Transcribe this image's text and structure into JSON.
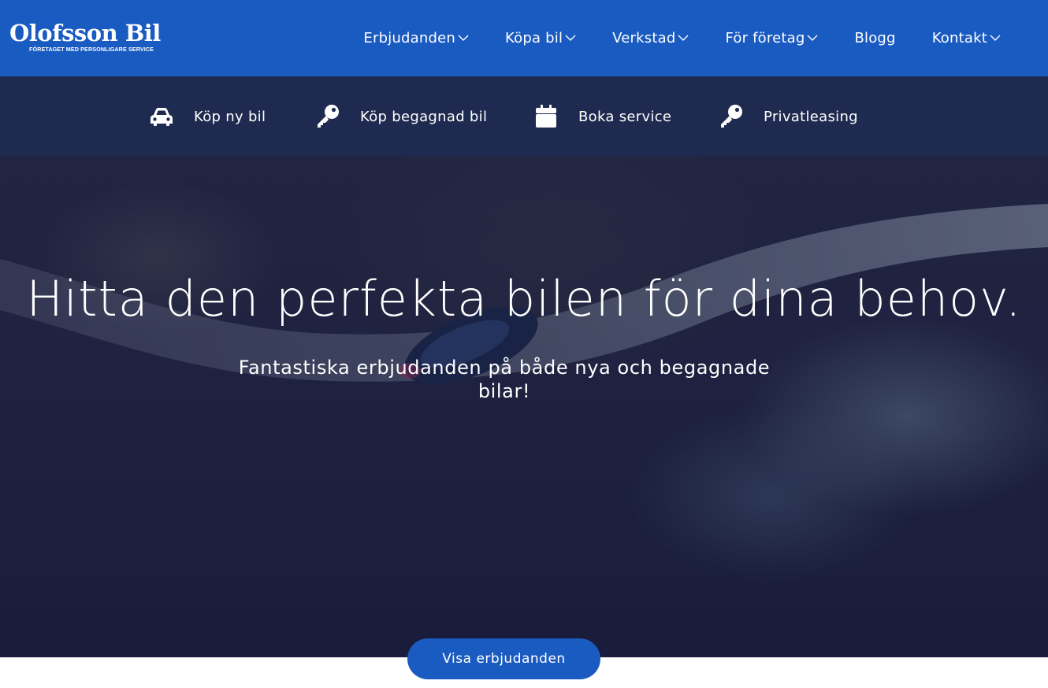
{
  "brand": {
    "name": "Olofsson Bil",
    "tagline": "FÖRETAGET MED PERSONLIGARE SERVICE"
  },
  "nav": {
    "items": [
      {
        "label": "Erbjudanden",
        "has_dropdown": true
      },
      {
        "label": "Köpa bil",
        "has_dropdown": true
      },
      {
        "label": "Verkstad",
        "has_dropdown": true
      },
      {
        "label": "För företag",
        "has_dropdown": true
      },
      {
        "label": "Blogg",
        "has_dropdown": false
      },
      {
        "label": "Kontakt",
        "has_dropdown": true
      }
    ]
  },
  "quicklinks": [
    {
      "label": "Köp ny bil",
      "icon": "car-icon"
    },
    {
      "label": "Köp begagnad bil",
      "icon": "key-icon"
    },
    {
      "label": "Boka service",
      "icon": "calendar-icon"
    },
    {
      "label": "Privatleasing",
      "icon": "key-icon"
    }
  ],
  "hero": {
    "title": "Hitta den perfekta bilen för dina behov.",
    "subtitle": "Fantastiska erbjudanden på både nya och begagnade bilar!",
    "cta_label": "Visa erbjudanden"
  },
  "colors": {
    "header_blue": "#1a5bc1",
    "quickbar_navy": "#1e2a4f",
    "button_blue": "#1a5bc1"
  }
}
